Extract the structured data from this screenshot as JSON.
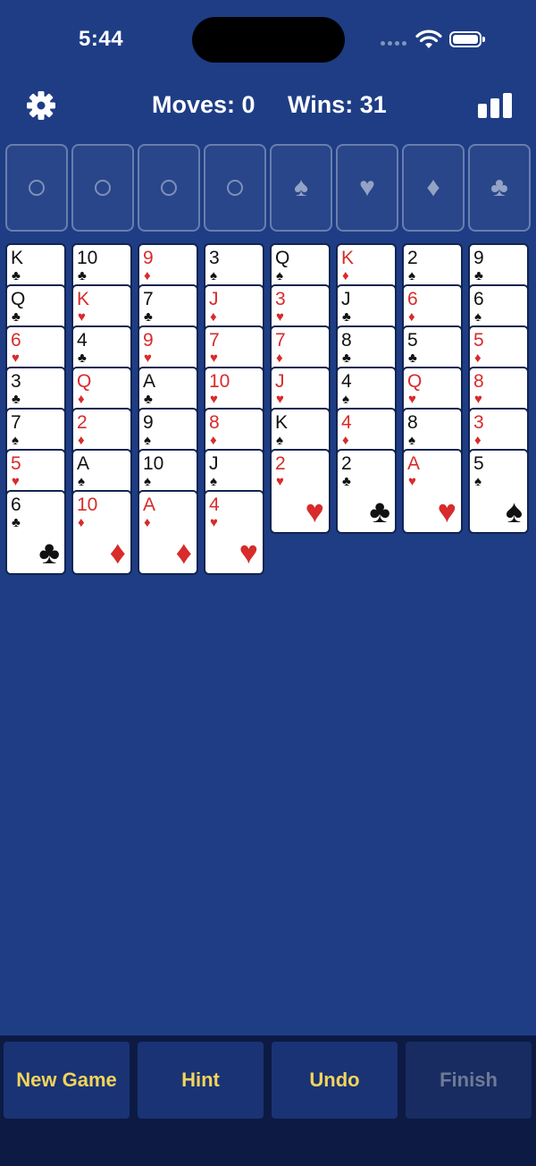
{
  "status_bar": {
    "time": "5:44",
    "icons": [
      "signal-icon",
      "wifi-icon",
      "battery-icon"
    ]
  },
  "header": {
    "moves_text": "Moves: 0",
    "wins_text": "Wins: 31",
    "left_icon": "gear-icon",
    "right_icon": "stats-icon"
  },
  "free_cells": [
    {
      "symbol": ""
    },
    {
      "symbol": ""
    },
    {
      "symbol": ""
    },
    {
      "symbol": ""
    }
  ],
  "foundations": [
    {
      "suit": "spades",
      "symbol": "♠"
    },
    {
      "suit": "hearts",
      "symbol": "♥"
    },
    {
      "suit": "diamonds",
      "symbol": "♦"
    },
    {
      "suit": "clubs",
      "symbol": "♣"
    }
  ],
  "tableau": [
    [
      {
        "rank": "K",
        "suit": "♣",
        "color": "black"
      },
      {
        "rank": "Q",
        "suit": "♣",
        "color": "black"
      },
      {
        "rank": "6",
        "suit": "♥",
        "color": "red"
      },
      {
        "rank": "3",
        "suit": "♣",
        "color": "black"
      },
      {
        "rank": "7",
        "suit": "♠",
        "color": "black"
      },
      {
        "rank": "5",
        "suit": "♥",
        "color": "red"
      },
      {
        "rank": "6",
        "suit": "♣",
        "color": "black"
      }
    ],
    [
      {
        "rank": "10",
        "suit": "♣",
        "color": "black"
      },
      {
        "rank": "K",
        "suit": "♥",
        "color": "red"
      },
      {
        "rank": "4",
        "suit": "♣",
        "color": "black"
      },
      {
        "rank": "Q",
        "suit": "♦",
        "color": "red"
      },
      {
        "rank": "2",
        "suit": "♦",
        "color": "red"
      },
      {
        "rank": "A",
        "suit": "♠",
        "color": "black"
      },
      {
        "rank": "10",
        "suit": "♦",
        "color": "red"
      }
    ],
    [
      {
        "rank": "9",
        "suit": "♦",
        "color": "red"
      },
      {
        "rank": "7",
        "suit": "♣",
        "color": "black"
      },
      {
        "rank": "9",
        "suit": "♥",
        "color": "red"
      },
      {
        "rank": "A",
        "suit": "♣",
        "color": "black"
      },
      {
        "rank": "9",
        "suit": "♠",
        "color": "black"
      },
      {
        "rank": "10",
        "suit": "♠",
        "color": "black"
      },
      {
        "rank": "A",
        "suit": "♦",
        "color": "red"
      }
    ],
    [
      {
        "rank": "3",
        "suit": "♠",
        "color": "black"
      },
      {
        "rank": "J",
        "suit": "♦",
        "color": "red"
      },
      {
        "rank": "7",
        "suit": "♥",
        "color": "red"
      },
      {
        "rank": "10",
        "suit": "♥",
        "color": "red"
      },
      {
        "rank": "8",
        "suit": "♦",
        "color": "red"
      },
      {
        "rank": "J",
        "suit": "♠",
        "color": "black"
      },
      {
        "rank": "4",
        "suit": "♥",
        "color": "red"
      }
    ],
    [
      {
        "rank": "Q",
        "suit": "♠",
        "color": "black"
      },
      {
        "rank": "3",
        "suit": "♥",
        "color": "red"
      },
      {
        "rank": "7",
        "suit": "♦",
        "color": "red"
      },
      {
        "rank": "J",
        "suit": "♥",
        "color": "red"
      },
      {
        "rank": "K",
        "suit": "♠",
        "color": "black"
      },
      {
        "rank": "2",
        "suit": "♥",
        "color": "red"
      }
    ],
    [
      {
        "rank": "K",
        "suit": "♦",
        "color": "red"
      },
      {
        "rank": "J",
        "suit": "♣",
        "color": "black"
      },
      {
        "rank": "8",
        "suit": "♣",
        "color": "black"
      },
      {
        "rank": "4",
        "suit": "♠",
        "color": "black"
      },
      {
        "rank": "4",
        "suit": "♦",
        "color": "red"
      },
      {
        "rank": "2",
        "suit": "♣",
        "color": "black"
      }
    ],
    [
      {
        "rank": "2",
        "suit": "♠",
        "color": "black"
      },
      {
        "rank": "6",
        "suit": "♦",
        "color": "red"
      },
      {
        "rank": "5",
        "suit": "♣",
        "color": "black"
      },
      {
        "rank": "Q",
        "suit": "♥",
        "color": "red"
      },
      {
        "rank": "8",
        "suit": "♠",
        "color": "black"
      },
      {
        "rank": "A",
        "suit": "♥",
        "color": "red"
      }
    ],
    [
      {
        "rank": "9",
        "suit": "♣",
        "color": "black"
      },
      {
        "rank": "6",
        "suit": "♠",
        "color": "black"
      },
      {
        "rank": "5",
        "suit": "♦",
        "color": "red"
      },
      {
        "rank": "8",
        "suit": "♥",
        "color": "red"
      },
      {
        "rank": "3",
        "suit": "♦",
        "color": "red"
      },
      {
        "rank": "5",
        "suit": "♠",
        "color": "black"
      }
    ]
  ],
  "toolbar": {
    "new_game_label": "New Game",
    "hint_label": "Hint",
    "undo_label": "Undo",
    "finish_label": "Finish",
    "finish_enabled": false
  },
  "colors": {
    "felt": "#1e3d85",
    "red_suit": "#d82b2b",
    "black_suit": "#111111",
    "button_text": "#f3d45c",
    "disabled_text": "#6f7a96"
  }
}
